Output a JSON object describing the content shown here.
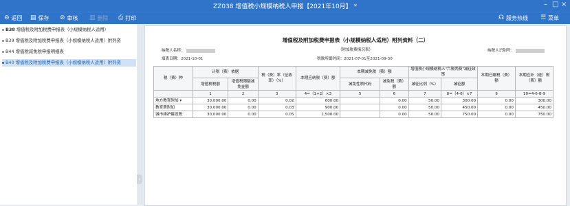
{
  "window": {
    "title": "ZZ038 增值税小规模纳税人申报【2021年10月】 *",
    "minimize": "–",
    "maximize": "□",
    "close": "×"
  },
  "toolbar": {
    "back": "返回",
    "save": "保存",
    "review": "审核",
    "delete": "删除",
    "print": "打印",
    "hotline": "服务热线",
    "menu": "菜单"
  },
  "sidebar": {
    "items": [
      {
        "code": "B38",
        "label": "增值税及附加税费申报表（小规模纳税人适用）"
      },
      {
        "code": "B39",
        "label": "增值税及附加税费申报表（小规模纳税人适用）附列资"
      },
      {
        "code": "B44",
        "label": "增值税减免税申报明细表"
      },
      {
        "code": "B40",
        "label": "增值税及附加税费申报表（小规模纳税人适用）附列资"
      }
    ]
  },
  "document": {
    "title": "增值税及附加税费申报表（小规模纳税人适用）附列资料（二）",
    "subtitle": "（附加税费情况表）",
    "taxpayer_name_label": "纳税人名称：",
    "taxpayer_id_label": "纳税人识别号：",
    "fill_date_label": "填表日期：",
    "fill_date": "2021-10-01",
    "period_label": "税款所属时间：",
    "period": "2021-07-01至2021-09-30"
  },
  "table": {
    "header": {
      "tax_type": "税（费）种",
      "basis_group": "计税（费）依据",
      "vat_amount": "增值税税额",
      "vat_reduction": "增值税限额减免金额",
      "rate": "税（费）率（征收率）（%）",
      "current_due": "本期应纳税（费）额",
      "relief_group": "本期减免税（费）额",
      "relief_code": "减免性质代码",
      "relief_amount": "减免税（费）额",
      "policy_group": "增值税小规模纳税人\"六税两费\"减征政策",
      "reduction_ratio": "减征比例（%）",
      "reduction_amount": "减征额",
      "paid": "本期已缴税（费）额",
      "refund": "本期应补（退）税（费）额"
    },
    "index_row": [
      "1",
      "2",
      "3",
      "4=（1+2）×3",
      "5",
      "6",
      "7",
      "8=（4-6）×7",
      "9",
      "10=4-6-8-9"
    ],
    "rows": [
      {
        "name": "地方教育附加",
        "c1": "30,000.00",
        "c2": "0.00",
        "c3": "0.02",
        "c4": "600.00",
        "c5": "",
        "c6": "0.00",
        "c7": "50.00",
        "c8": "300.00",
        "c9": "0.00",
        "c10": "300.00"
      },
      {
        "name": "教育费附加",
        "c1": "30,000.00",
        "c2": "0.00",
        "c3": "0.03",
        "c4": "900.00",
        "c5": "",
        "c6": "0.00",
        "c7": "50.00",
        "c8": "450.00",
        "c9": "0.00",
        "c10": "450.00"
      },
      {
        "name": "城市维护建设税",
        "c1": "30,000.00",
        "c2": "0.00",
        "c3": "0.05",
        "c4": "1,500.00",
        "c5": "",
        "c6": "0.00",
        "c7": "50.00",
        "c8": "750.00",
        "c9": "0.00",
        "c10": "750.00"
      }
    ]
  },
  "colors": {
    "titlebar": "#2f74c9",
    "active_item": "#cfe2f8"
  },
  "icons": [
    "back-icon",
    "save-icon",
    "review-icon",
    "delete-icon",
    "print-icon",
    "headset-icon",
    "menu-icon",
    "collapse-arrow-icon"
  ]
}
